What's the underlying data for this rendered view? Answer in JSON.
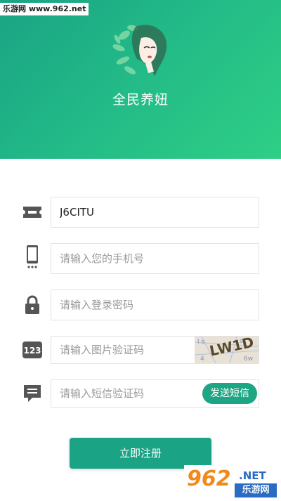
{
  "watermark": {
    "top_left": "乐游网 www.962.net",
    "bottom_right_number": "962",
    "bottom_right_domain": ".NET",
    "bottom_right_cn": "乐游网"
  },
  "header": {
    "app_title": "全民养妞"
  },
  "form": {
    "invite_code": {
      "icon": "ticket-icon",
      "value": "J6CITU"
    },
    "phone": {
      "icon": "phone-icon",
      "placeholder": "请输入您的手机号"
    },
    "password": {
      "icon": "lock-icon",
      "placeholder": "请输入登录密码"
    },
    "image_code": {
      "icon": "number-123-icon",
      "placeholder": "请输入图片验证码",
      "captcha_text": "LW1D"
    },
    "sms_code": {
      "icon": "message-icon",
      "placeholder": "请输入短信验证码",
      "send_label": "发送短信"
    }
  },
  "register_label": "立即注册",
  "colors": {
    "accent": "#1da584",
    "icon": "#555555"
  }
}
